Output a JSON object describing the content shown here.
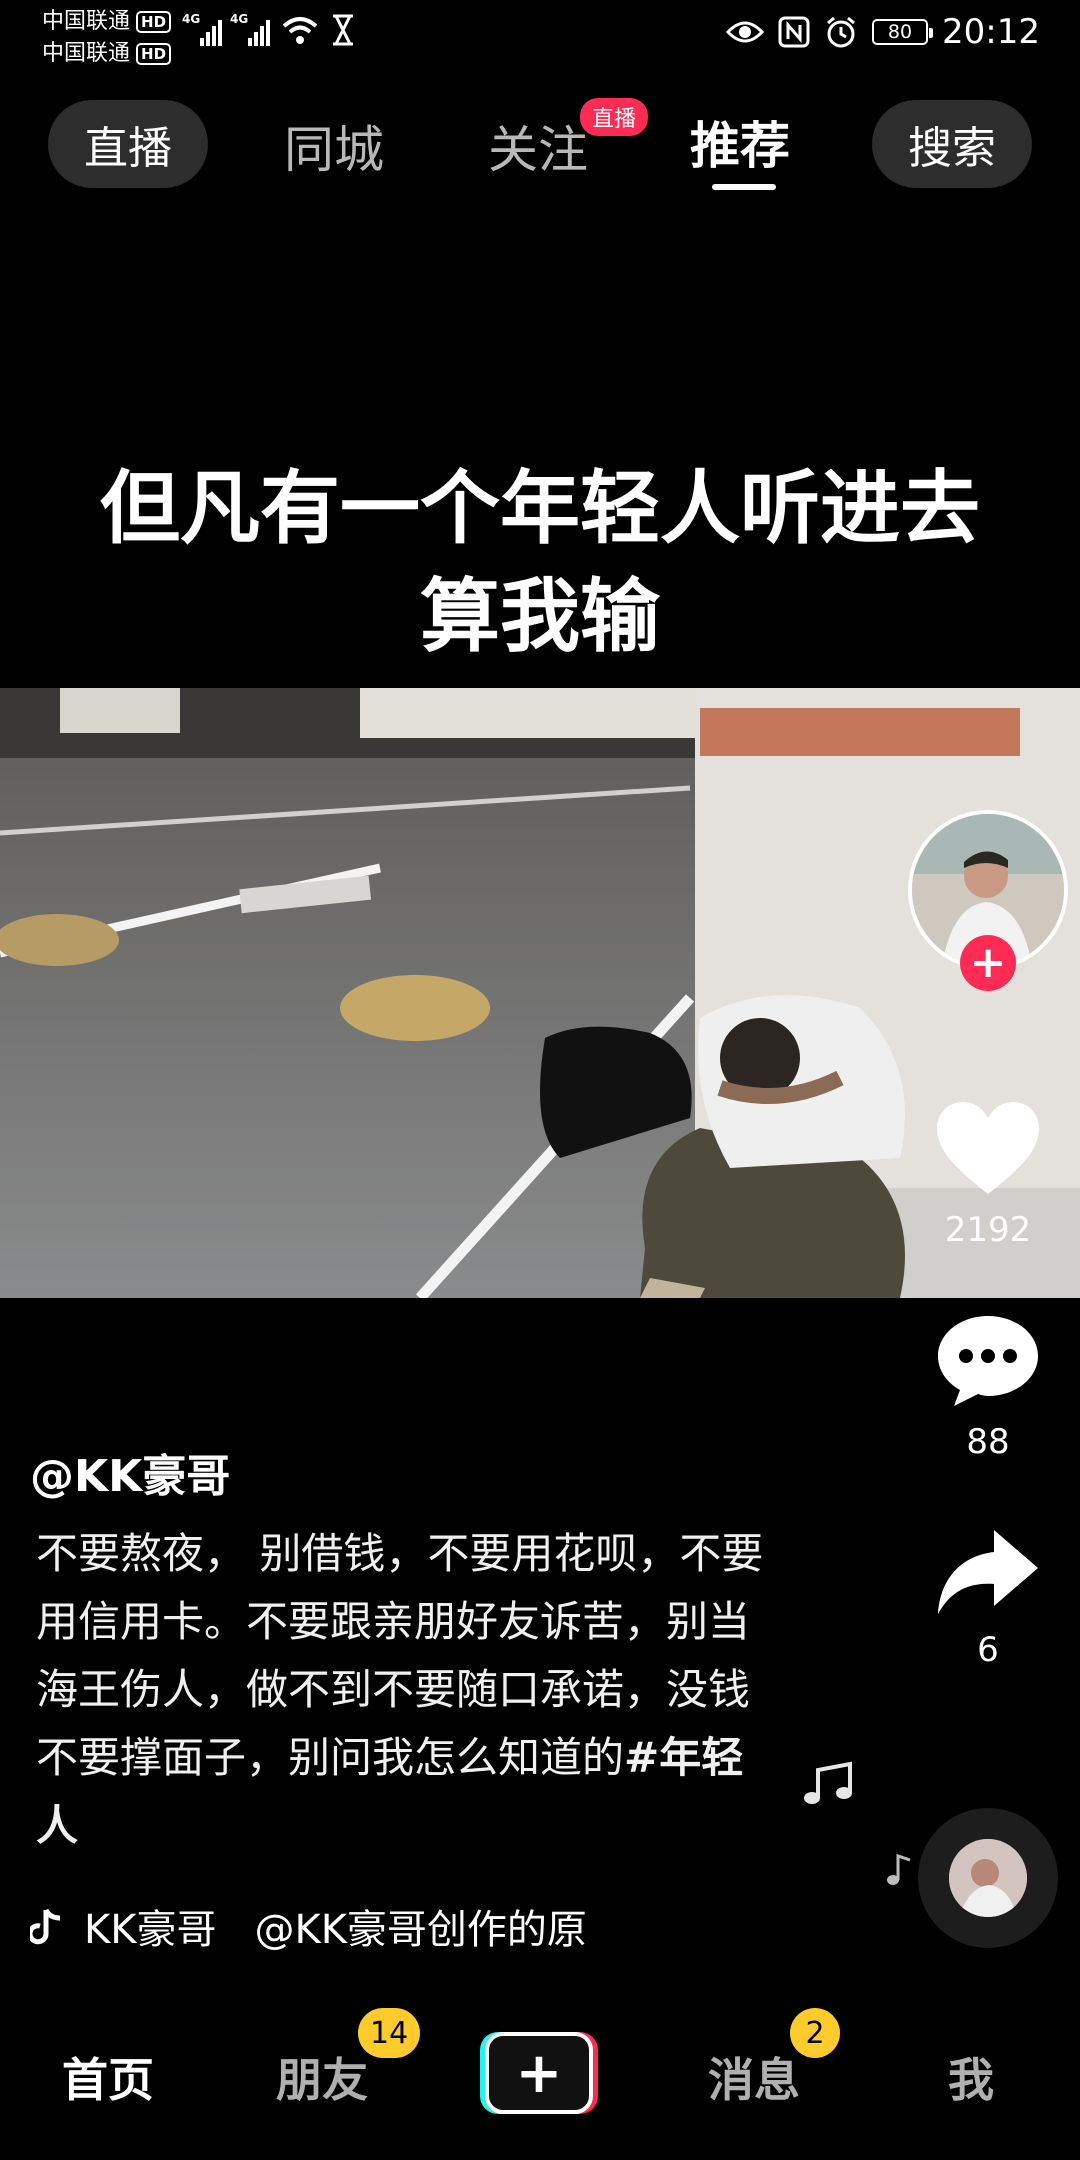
{
  "status_bar": {
    "carrier_1": "中国联通",
    "carrier_2": "中国联通",
    "hd_label": "HD",
    "net_label": "4G",
    "battery": "80",
    "time": "20:12"
  },
  "top_nav": {
    "live": "直播",
    "local": "同城",
    "following": "关注",
    "following_badge": "直播",
    "recommend": "推荐",
    "search": "搜索"
  },
  "video": {
    "caption_line1": "但凡有一个年轻人听进去",
    "caption_line2": "算我输"
  },
  "actions": {
    "likes": "2192",
    "comments": "88",
    "shares": "6"
  },
  "post": {
    "author": "@KK豪哥",
    "description": "不要熬夜， 别借钱，不要用花呗，不要用信用卡。不要跟亲朋好友诉苦，别当海王伤人，做不到不要随口承诺，没钱不要撑面子，别问我怎么知道的",
    "hashtag": "#年轻人",
    "music_author": "KK豪哥",
    "music_title": "@KK豪哥创作的原"
  },
  "bottom_nav": {
    "home": "首页",
    "friends": "朋友",
    "friends_badge": "14",
    "messages": "消息",
    "messages_badge": "2",
    "me": "我",
    "plus": "+"
  },
  "colors": {
    "accent_red": "#fe2c55",
    "badge_yellow": "#fecb2d",
    "cyan": "#25f4ee"
  }
}
